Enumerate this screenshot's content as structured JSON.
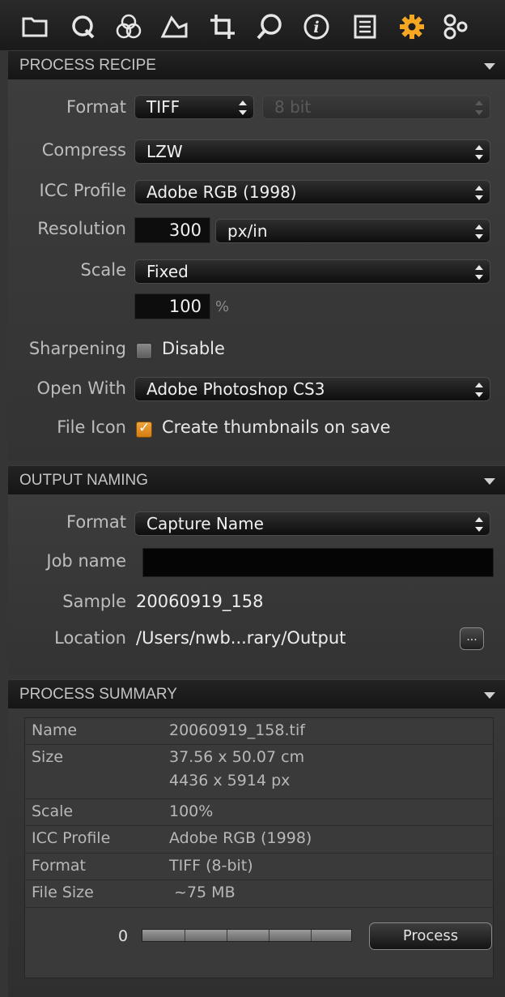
{
  "toolbar": {
    "icons": [
      "folder-icon",
      "capture-q-icon",
      "color-circles-icon",
      "exposure-icon",
      "crop-icon",
      "focus-loupe-icon",
      "info-icon",
      "details-list-icon",
      "gear-icon",
      "batch-icon"
    ],
    "active_color": "#f5a623"
  },
  "process_recipe": {
    "title": "PROCESS RECIPE",
    "format_label": "Format",
    "format_value": "TIFF",
    "bitdepth_value": "8 bit",
    "compress_label": "Compress",
    "compress_value": "LZW",
    "icc_label": "ICC Profile",
    "icc_value": "Adobe RGB (1998)",
    "resolution_label": "Resolution",
    "resolution_value": "300",
    "resolution_unit": "px/in",
    "scale_label": "Scale",
    "scale_value": "Fixed",
    "scale_percent": "100",
    "percent_symbol": "%",
    "sharpening_label": "Sharpening",
    "sharpening_checked": false,
    "sharpening_option": "Disable",
    "open_with_label": "Open With",
    "open_with_value": "Adobe Photoshop CS3",
    "file_icon_label": "File Icon",
    "file_icon_checked": true,
    "file_icon_option": "Create thumbnails on save"
  },
  "output_naming": {
    "title": "OUTPUT NAMING",
    "format_label": "Format",
    "format_value": "Capture Name",
    "job_name_label": "Job name",
    "job_name_value": "",
    "sample_label": "Sample",
    "sample_value": "20060919_158",
    "location_label": "Location",
    "location_value": "/Users/nwb...rary/Output",
    "browse_label": "..."
  },
  "process_summary": {
    "title": "PROCESS SUMMARY",
    "rows": [
      {
        "label": "Name",
        "value": "20060919_158.tif"
      },
      {
        "label": "Size",
        "value": "37.56 x 50.07 cm",
        "value2": "4436 x 5914 px"
      },
      {
        "label": "Scale",
        "value": "100%"
      },
      {
        "label": "ICC Profile",
        "value": "Adobe RGB (1998)"
      },
      {
        "label": "Format",
        "value": "TIFF (8-bit)"
      },
      {
        "label": "File Size",
        "value": " ~75 MB"
      }
    ]
  },
  "footer": {
    "progress_count": "0",
    "progress_fraction": 0,
    "process_label": "Process"
  }
}
